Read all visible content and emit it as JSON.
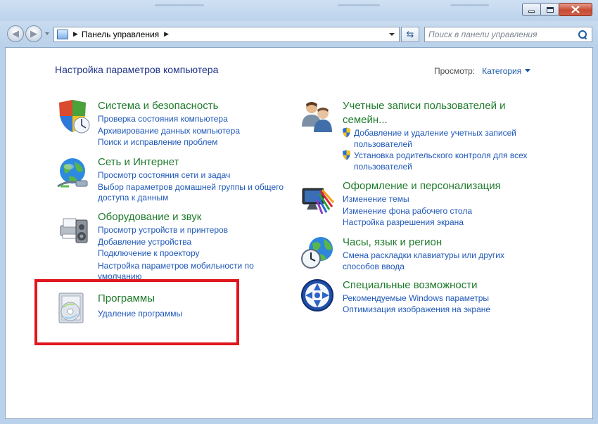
{
  "window": {
    "controls": [
      "minimize",
      "maximize",
      "close"
    ]
  },
  "nav": {
    "address_path": "Панель управления",
    "search_placeholder": "Поиск в панели управления"
  },
  "content": {
    "heading": "Настройка параметров компьютера",
    "view_by_label": "Просмотр:",
    "view_by_value": "Категория"
  },
  "categories_left": [
    {
      "icon": "security-shield-icon",
      "title": "Система и безопасность",
      "links": [
        "Проверка состояния компьютера",
        "Архивирование данных компьютера",
        "Поиск и исправление проблем"
      ]
    },
    {
      "icon": "network-globe-icon",
      "title": "Сеть и Интернет",
      "links": [
        "Просмотр состояния сети и задач",
        "Выбор параметров домашней группы и общего",
        "доступа к данным"
      ]
    },
    {
      "icon": "printer-speaker-icon",
      "title": "Оборудование и звук",
      "links": [
        "Просмотр устройств и принтеров",
        "Добавление устройства",
        "Подключение к проектору",
        "Настройка параметров мобильности по",
        "умолчанию"
      ]
    },
    {
      "icon": "programs-disc-icon",
      "title": "Программы",
      "links": [
        "Удаление программы"
      ]
    }
  ],
  "categories_right": [
    {
      "icon": "user-accounts-icon",
      "title_line1": "Учетные записи пользователей и",
      "title_line2": "семейн...",
      "links": [
        "Добавление и удаление учетных записей",
        "пользователей",
        "Установка родительского контроля для всех",
        "пользователей"
      ]
    },
    {
      "icon": "appearance-monitor-icon",
      "title": "Оформление и персонализация",
      "links": [
        "Изменение темы",
        "Изменение фона рабочего стола",
        "Настройка разрешения экрана"
      ]
    },
    {
      "icon": "clock-globe-icon",
      "title": "Часы, язык и регион",
      "links": [
        "Смена раскладки клавиатуры или других",
        "способов ввода"
      ]
    },
    {
      "icon": "accessibility-icon",
      "title": "Специальные возможности",
      "links": [
        "Рекомендуемые Windows параметры",
        "Оптимизация изображения на экране"
      ]
    }
  ],
  "colors": {
    "category_title": "#1f7a2c",
    "link": "#1f58b8",
    "heading": "#1e3287",
    "highlight_box": "#e0161e"
  }
}
